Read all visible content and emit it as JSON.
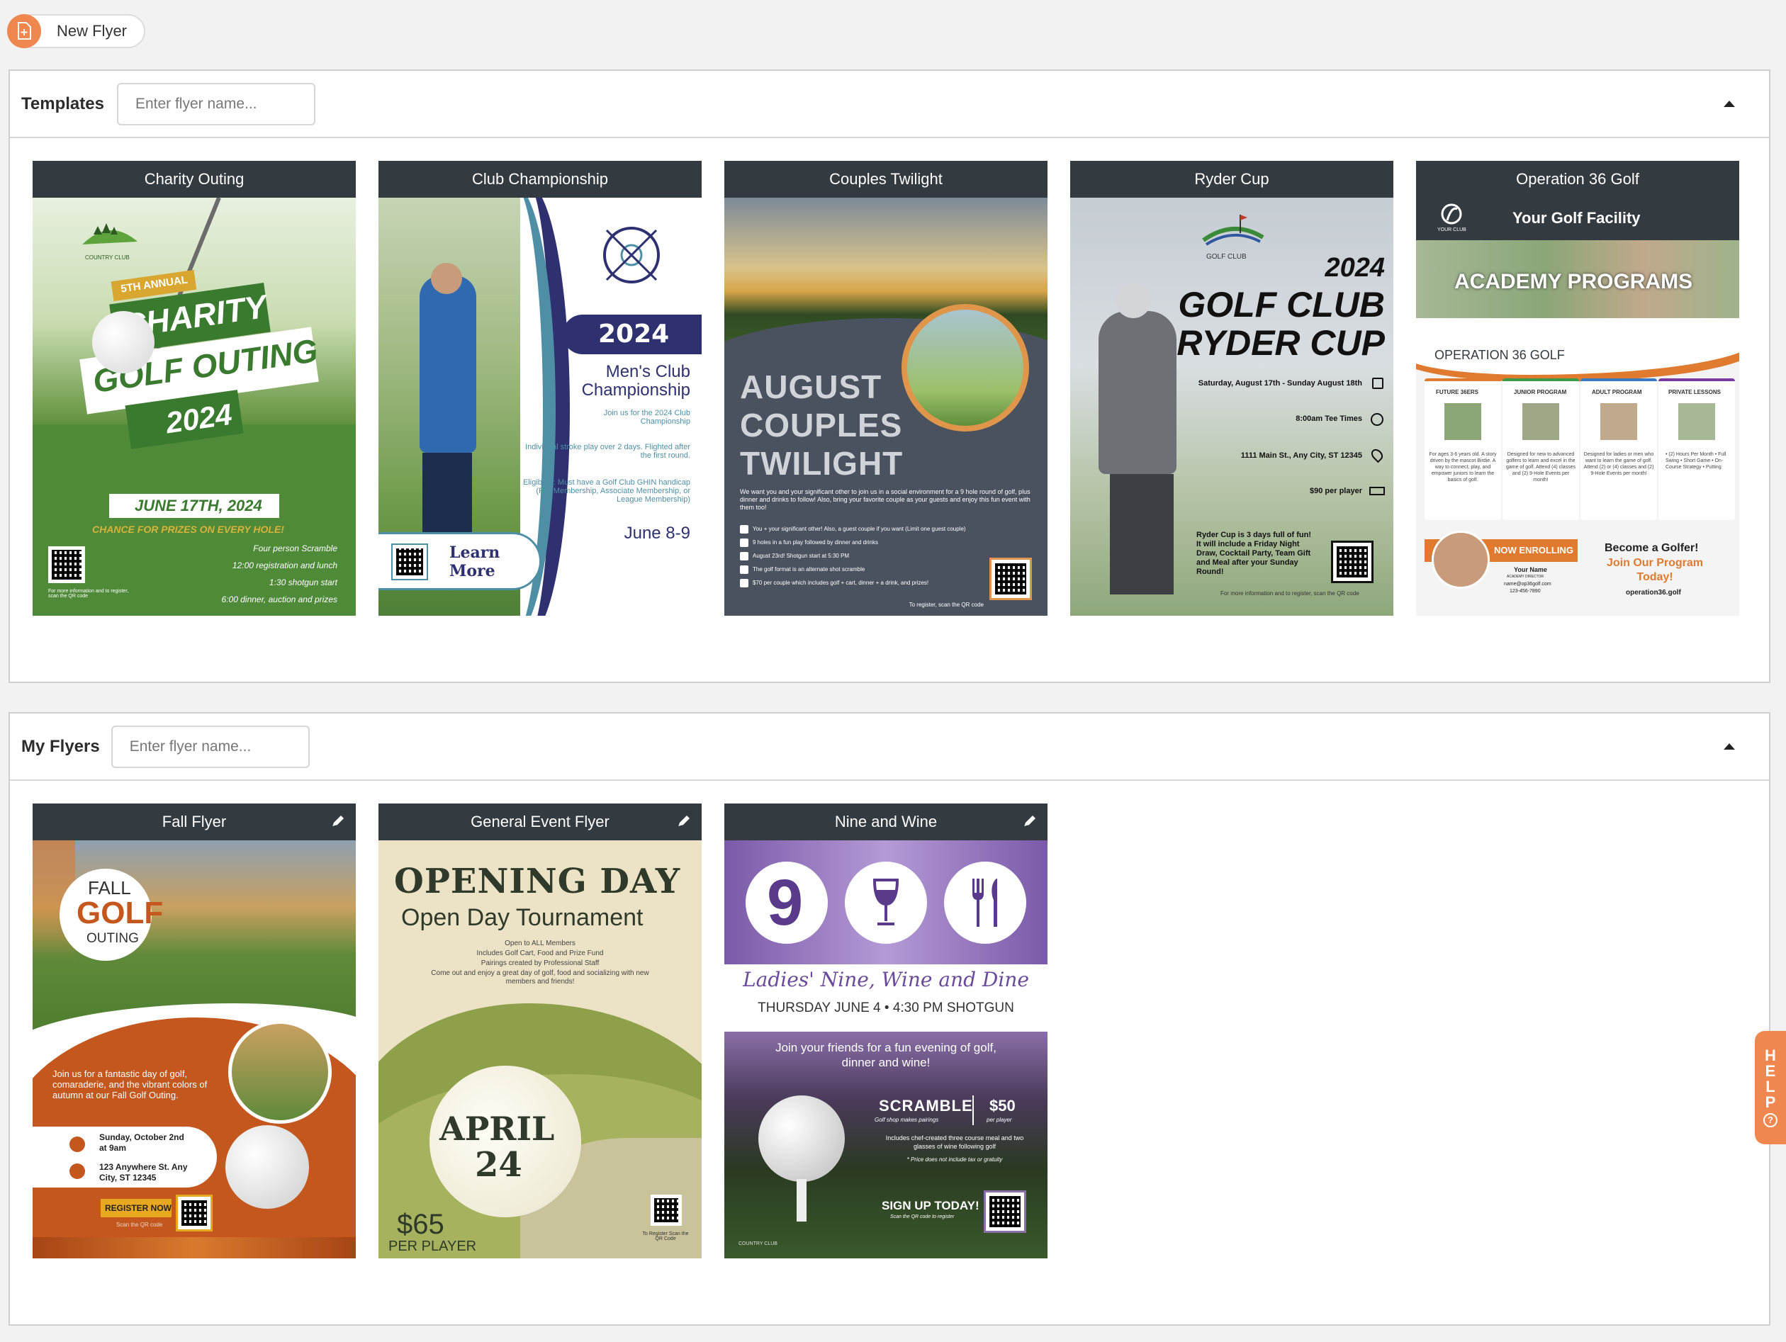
{
  "toolbar": {
    "new_flyer_label": "New Flyer"
  },
  "templates": {
    "title": "Templates",
    "search_placeholder": "Enter flyer name...",
    "cards": [
      {
        "title": "Charity Outing",
        "club": "COUNTRY CLUB",
        "annual": "5TH ANNUAL",
        "line1": "CHARITY",
        "line2": "GOLF OUTING",
        "year": "2024",
        "date": "JUNE 17TH, 2024",
        "prizes": "CHANCE FOR PRIZES ON EVERY HOLE!",
        "details": [
          "Four person Scramble",
          "12:00 registration and lunch",
          "1:30 shotgun start",
          "6:00 dinner, auction and prizes"
        ],
        "note": "For more information and to register, scan the QR code"
      },
      {
        "title": "Club Championship",
        "logo": "GOLF CLUB LOGO",
        "year": "2024",
        "line1": "Men's Club",
        "line2": "Championship",
        "join": "Join us for the 2024 Club Championship",
        "desc": "Individual stroke play over 2 days. Flighted after the first round.",
        "elig": "Eligibility: Must have a Golf Club GHIN handicap (Full Membership, Associate Membership, or League Membership)",
        "date": "June 8-9",
        "cta": "Learn More"
      },
      {
        "title": "Couples Twilight",
        "line1": "AUGUST",
        "line2": "COUPLES",
        "line3": "TWILIGHT",
        "desc": "We want you and your significant other to join us in a social environment for a 9 hole round of golf, plus dinner and drinks to follow! Also, bring your favorite couple as your guests and enjoy this fun event with them too!",
        "items": [
          "You + your significant other! Also, a guest couple if you want (Limit one guest couple)",
          "9 holes in a fun play followed by dinner and drinks",
          "August 23rd! Shotgun start at 5:30 PM",
          "The golf format is an alternate shot scramble",
          "$70 per couple which includes golf + cart, dinner + a drink, and prizes!"
        ],
        "note": "To register, scan the QR code"
      },
      {
        "title": "Ryder Cup",
        "club": "GOLF CLUB",
        "year": "2024",
        "line1": "GOLF CLUB",
        "line2": "RYDER CUP",
        "info": [
          "Saturday, August 17th - Sunday August 18th",
          "8:00am Tee Times",
          "1111 Main St., Any City, ST 12345",
          "$90 per player"
        ],
        "desc": "Ryder Cup is 3 days full of fun! It will include a Friday Night Draw, Cocktail Party, Team Gift and Meal after your Sunday Round!",
        "note": "For more information and to register, scan the QR code"
      },
      {
        "title": "Operation 36 Golf",
        "your_club": "YOUR CLUB",
        "facility": "Your Golf Facility",
        "academy": "ACADEMY PROGRAMS",
        "brand": "OPERATION 36 GOLF",
        "programs": [
          {
            "name": "FUTURE 36ERS",
            "text": "For ages 3-6 years old. A story driven by the mascot Birdie. A way to connect, play, and empower juniors to learn the basics of golf."
          },
          {
            "name": "JUNIOR PROGRAM",
            "text": "Designed for new to advanced golfers to learn and excel in the game of golf. Attend (4) classes and (2) 9-Hole Events per month!"
          },
          {
            "name": "ADULT PROGRAM",
            "text": "Designed for ladies or men who want to learn the game of golf. Attend (2) or (4) classes and (2) 9-Hole Events per month!"
          },
          {
            "name": "PRIVATE LESSONS",
            "text": "• (2) Hours Per Month • Full Swing • Short Game • On-Course Strategy • Putting"
          }
        ],
        "enrolling": "NOW ENROLLING",
        "coach_name": "Your Name",
        "coach_title": "ACADEMY DIRECTOR",
        "coach_email": "name@op36golf.com",
        "coach_phone": "123-456-7890",
        "become": "Become a Golfer!",
        "join": "Join Our Program Today!",
        "site": "operation36.golf"
      }
    ]
  },
  "my_flyers": {
    "title": "My Flyers",
    "search_placeholder": "Enter flyer name...",
    "cards": [
      {
        "title": "Fall Flyer",
        "fall": "FALL",
        "golf": "GOLF",
        "outing": "OUTING",
        "desc": "Join us for a fantastic day of golf, comaraderie, and the vibrant colors of autumn at our Fall Golf Outing.",
        "date": "Sunday, October 2nd at 9am",
        "addr": "123 Anywhere St. Any City, ST 12345",
        "cta": "REGISTER NOW",
        "scan": "Scan the QR code"
      },
      {
        "title": "General Event Flyer",
        "head": "OPENING DAY",
        "sub": "Open Day Tournament",
        "details": [
          "Open to ALL Members",
          "Includes Golf Cart, Food and Prize Fund",
          "Pairings created by Professional Staff",
          "Come out and enjoy a great day of golf, food and socializing with new members and friends!"
        ],
        "month": "APRIL",
        "day": "24",
        "price": "$65",
        "per": "PER PLAYER",
        "note": "To Register Scan the QR Code"
      },
      {
        "title": "Nine and Wine",
        "nine": "9",
        "script": "Ladies' Nine, Wine and Dine",
        "date": "THURSDAY JUNE 4 • 4:30 PM SHOTGUN",
        "join": "Join your friends for a fun evening of golf, dinner and wine!",
        "scramble": "SCRAMBLE",
        "scramble_sub": "Golf shop makes pairings",
        "price": "$50",
        "price_sub": "per player",
        "includes": "Includes chef-created three course meal and two glasses of wine following golf",
        "tax": "* Price does not include tax or gratuity",
        "signup": "SIGN UP TODAY!",
        "signup_sub": "Scan the QR code to register",
        "club": "COUNTRY CLUB"
      }
    ]
  },
  "help": {
    "label": [
      "H",
      "E",
      "L",
      "P"
    ]
  },
  "colors": {
    "accent": "#f0874e",
    "card_header": "#333a40"
  }
}
